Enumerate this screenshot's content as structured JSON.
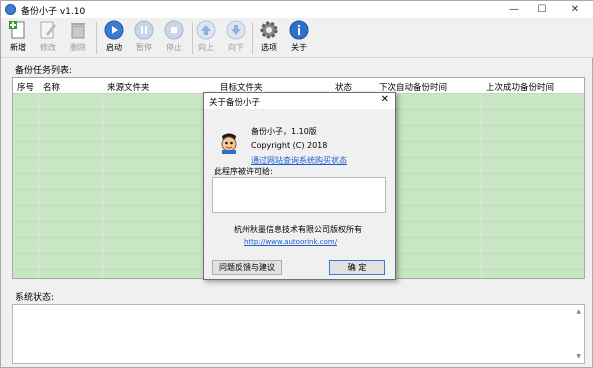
{
  "window": {
    "title": "备份小子 v1.10"
  },
  "toolbar": {
    "new": "新增",
    "edit": "修改",
    "delete": "删除",
    "start": "启动",
    "pause": "暂停",
    "stop": "停止",
    "up": "向上",
    "down": "向下",
    "options": "选项",
    "about": "关于"
  },
  "task_list": {
    "label": "备份任务列表:",
    "columns": [
      "序号",
      "名称",
      "来源文件夹",
      "目标文件夹",
      "状态",
      "下次自动备份时间",
      "上次成功备份时间"
    ]
  },
  "status": {
    "label": "系统状态:"
  },
  "about_dialog": {
    "title": "关于备份小子",
    "version": "备份小子，1.10版",
    "copyright": "Copyright (C) 2018",
    "purchase_link": "通过网站查询系统购买状态",
    "license_label": "此程序被许可给:",
    "license_value": "",
    "company": "杭州秋墨信息技术有限公司版权所有",
    "url": "http://www.autoorink.com/",
    "feedback_button": "问题反馈与建议",
    "ok_button": "确 定"
  },
  "colors": {
    "grid_bg": "#c9e6c4",
    "accent": "#3a7bd5",
    "link": "#1a5fd0"
  }
}
